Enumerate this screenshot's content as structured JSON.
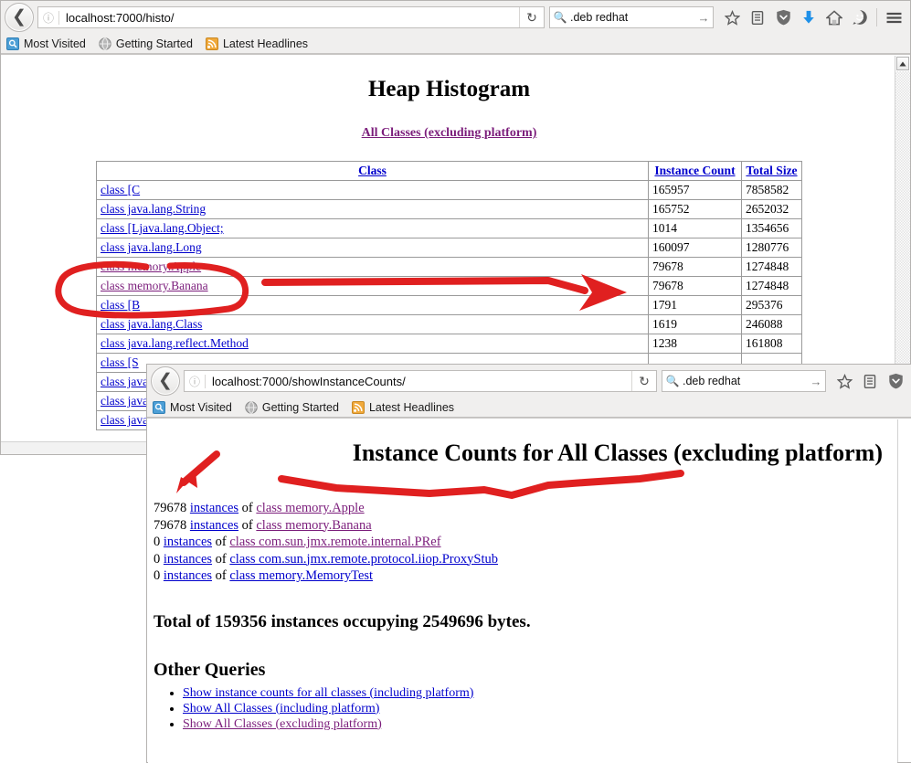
{
  "window1": {
    "url": "localhost:7000/histo/",
    "url_host": "localhost",
    "url_path": ":7000/histo/",
    "search_query": ".deb redhat",
    "bookmarks": [
      {
        "label": "Most Visited",
        "icon": "bookmark-page-icon"
      },
      {
        "label": "Getting Started",
        "icon": "globe-icon"
      },
      {
        "label": "Latest Headlines",
        "icon": "rss-feed-icon"
      }
    ],
    "toolbar_icons": [
      "star-icon",
      "library-icon",
      "shield-icon",
      "download-arrow-icon",
      "home-icon",
      "smiley-face-icon",
      "hamburger-menu-icon"
    ],
    "page": {
      "title": "Heap Histogram",
      "subtitle_link": "All Classes (excluding platform)",
      "table": {
        "headers": [
          "Class",
          "Instance Count",
          "Total Size"
        ],
        "rows": [
          {
            "cls": "class [C",
            "count": "165957",
            "size": "7858582",
            "visited": false
          },
          {
            "cls": "class java.lang.String",
            "count": "165752",
            "size": "2652032",
            "visited": false
          },
          {
            "cls": "class [Ljava.lang.Object;",
            "count": "1014",
            "size": "1354656",
            "visited": false
          },
          {
            "cls": "class java.lang.Long",
            "count": "160097",
            "size": "1280776",
            "visited": false
          },
          {
            "cls": "class memory.Apple",
            "count": "79678",
            "size": "1274848",
            "visited": true
          },
          {
            "cls": "class memory.Banana",
            "count": "79678",
            "size": "1274848",
            "visited": true
          },
          {
            "cls": "class [B",
            "count": "1791",
            "size": "295376",
            "visited": false
          },
          {
            "cls": "class java.lang.Class",
            "count": "1619",
            "size": "246088",
            "visited": false
          },
          {
            "cls": "class java.lang.reflect.Method",
            "count": "1238",
            "size": "161808",
            "visited": false
          },
          {
            "cls": "class [S",
            "count": "",
            "size": "",
            "visited": false
          },
          {
            "cls": "class java",
            "count": "",
            "size": "",
            "visited": false
          },
          {
            "cls": "class java",
            "count": "",
            "size": "",
            "visited": false
          },
          {
            "cls": "class java",
            "count": "",
            "size": "",
            "visited": false
          }
        ]
      }
    }
  },
  "window2": {
    "url": "localhost:7000/showInstanceCounts/",
    "url_host": "localhost",
    "url_path": ":7000/showInstanceCounts/",
    "search_query": ".deb redhat",
    "bookmarks": [
      {
        "label": "Most Visited",
        "icon": "bookmark-page-icon"
      },
      {
        "label": "Getting Started",
        "icon": "globe-icon"
      },
      {
        "label": "Latest Headlines",
        "icon": "rss-feed-icon"
      }
    ],
    "toolbar_icons": [
      "star-icon",
      "library-icon",
      "shield-icon"
    ],
    "page": {
      "title": "Instance Counts for All Classes (excluding platform)",
      "counts": [
        {
          "count": "79678",
          "instances_label": "instances",
          "of": "of",
          "cls": "class memory.Apple",
          "visited": true
        },
        {
          "count": "79678",
          "instances_label": "instances",
          "of": "of",
          "cls": "class memory.Banana",
          "visited": true
        },
        {
          "count": "0",
          "instances_label": "instances",
          "of": "of",
          "cls": "class com.sun.jmx.remote.internal.PRef",
          "visited": true
        },
        {
          "count": "0",
          "instances_label": "instances",
          "of": "of",
          "cls": "class com.sun.jmx.remote.protocol.iiop.ProxyStub",
          "visited": false
        },
        {
          "count": "0",
          "instances_label": "instances",
          "of": "of",
          "cls": "class memory.MemoryTest",
          "visited": false
        }
      ],
      "total_line": "Total of 159356 instances occupying 2549696 bytes.",
      "other_queries_heading": "Other Queries",
      "other_queries": [
        {
          "label": "Show instance counts for all classes (including platform)",
          "visited": false
        },
        {
          "label": "Show All Classes (including platform)",
          "visited": false
        },
        {
          "label": "Show All Classes (excluding platform)",
          "visited": true
        }
      ]
    }
  },
  "annotations": {
    "color": "#e02020",
    "items": [
      {
        "name": "circle-around-memory-classes"
      },
      {
        "name": "right-arrow-to-instance-count"
      },
      {
        "name": "down-left-arrow-to-counts"
      },
      {
        "name": "underline-squiggle-under-title"
      }
    ]
  }
}
